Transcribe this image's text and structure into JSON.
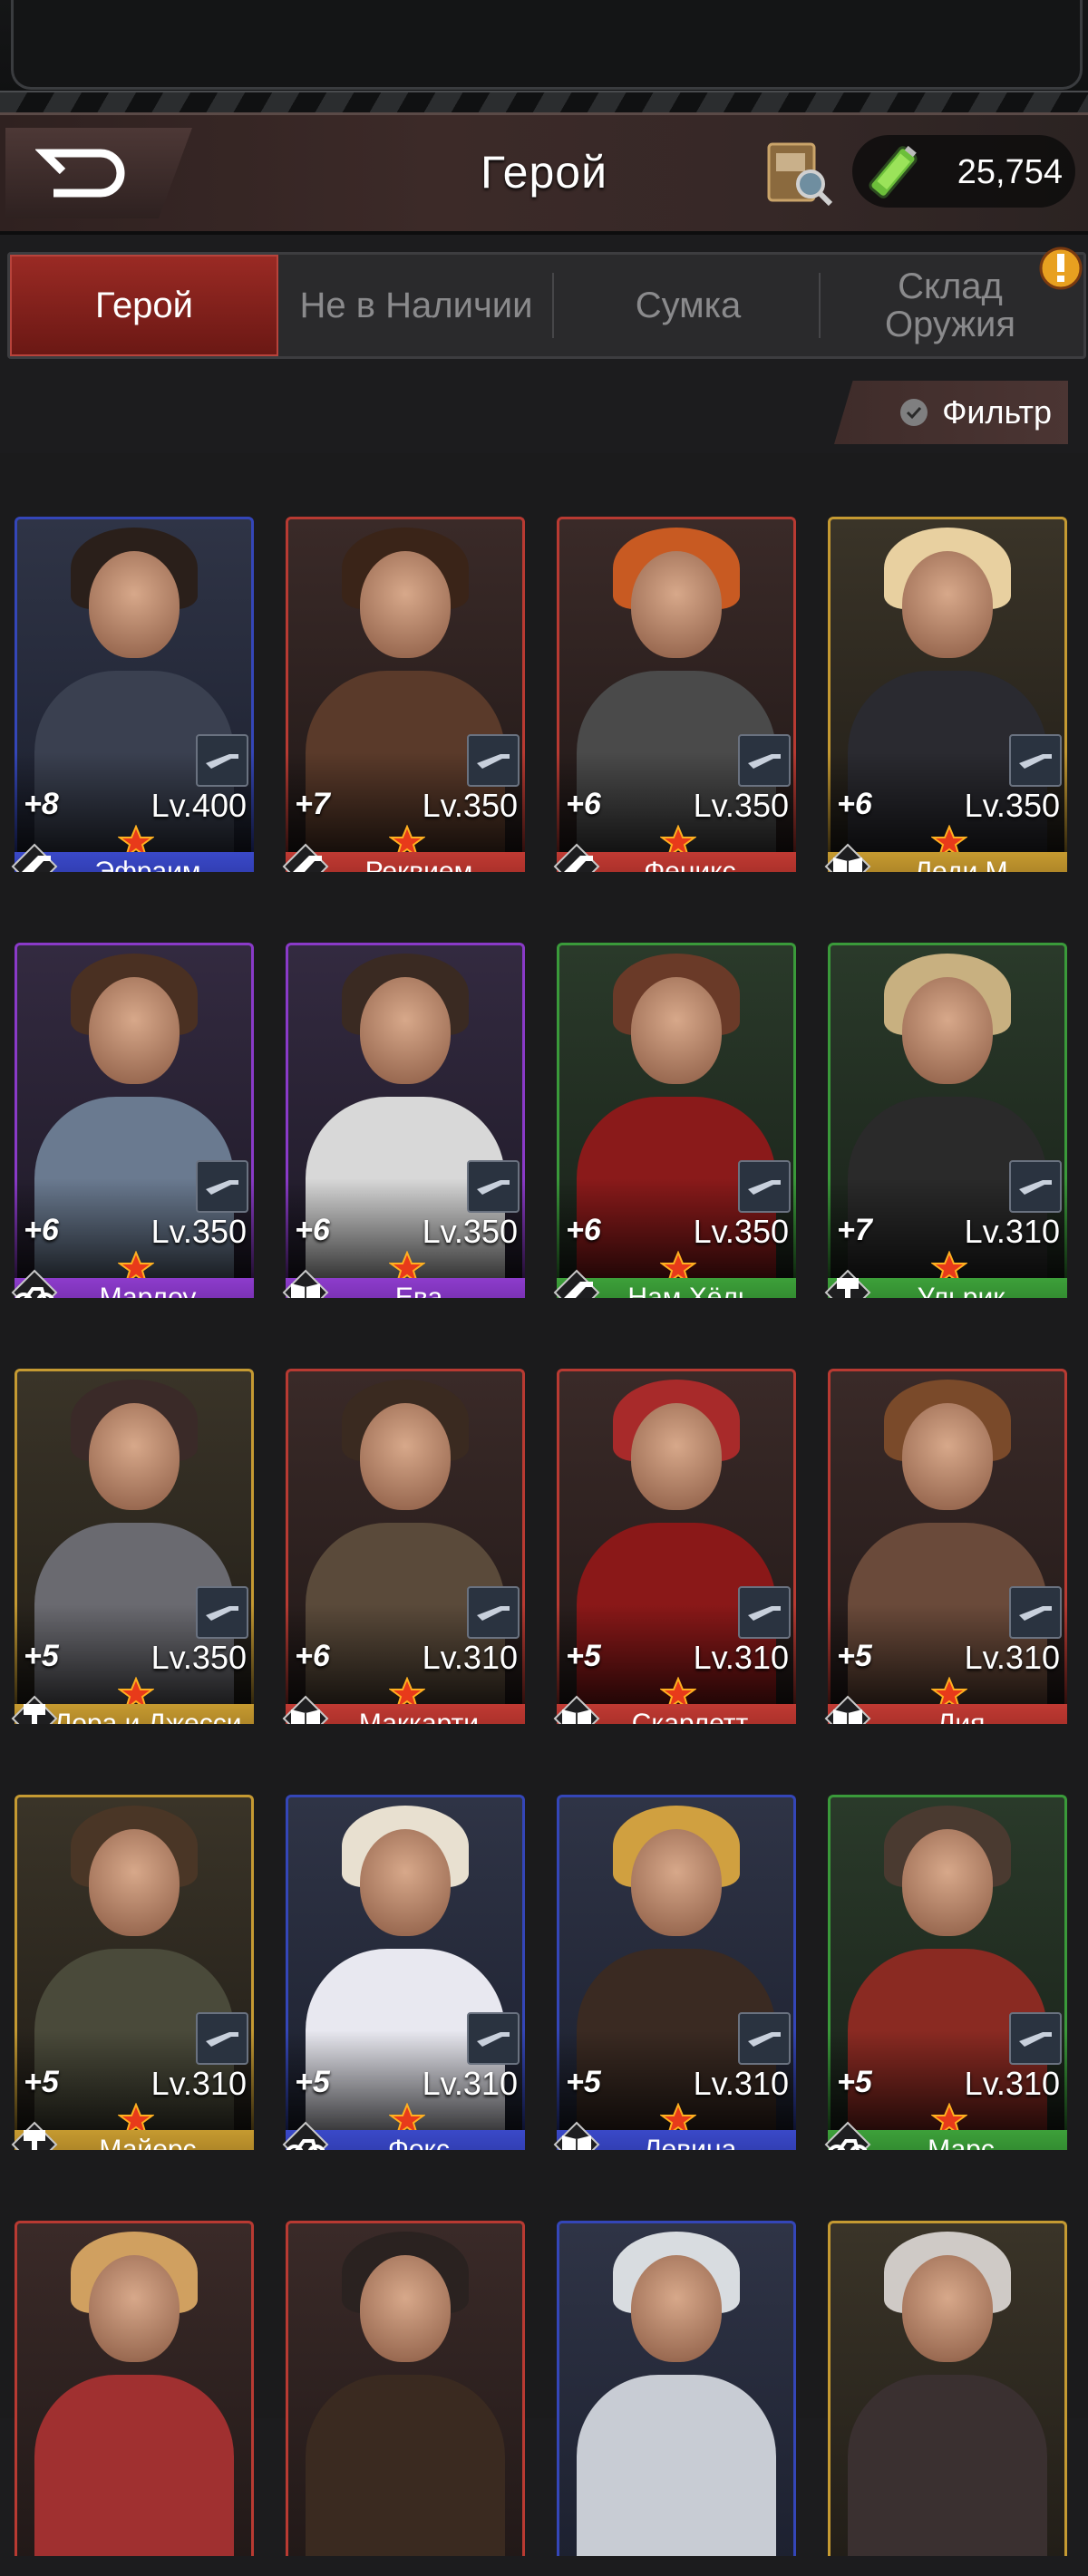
{
  "header": {
    "title": "Герой",
    "currency_value": "25,754",
    "back_icon": "back-arrow-icon",
    "book_icon": "hero-book-search-icon",
    "currency_icon": "green-battery-icon"
  },
  "tabs": [
    {
      "label": "Герой",
      "active": true
    },
    {
      "label": "Не в Наличии",
      "active": false
    },
    {
      "label": "Сумка",
      "active": false
    },
    {
      "label": "Склад Оружия",
      "active": false
    }
  ],
  "filter": {
    "label": "Фильтр"
  },
  "heroes": [
    {
      "name": "Эфраим",
      "plus": "+8",
      "level": "Lv.400",
      "rarity": "blue",
      "class_icon": "rifle-icon"
    },
    {
      "name": "Реквием",
      "plus": "+7",
      "level": "Lv.350",
      "rarity": "red",
      "class_icon": "rifle-icon"
    },
    {
      "name": "Феникс",
      "plus": "+6",
      "level": "Lv.350",
      "rarity": "red",
      "class_icon": "rifle-icon"
    },
    {
      "name": "Леди М",
      "plus": "+6",
      "level": "Lv.350",
      "rarity": "gold",
      "class_icon": "book-icon"
    },
    {
      "name": "Марлоу",
      "plus": "+6",
      "level": "Lv.350",
      "rarity": "purple",
      "class_icon": "motorcycle-icon"
    },
    {
      "name": "Ева",
      "plus": "+6",
      "level": "Lv.350",
      "rarity": "purple",
      "class_icon": "book-icon"
    },
    {
      "name": "Нам Хёль",
      "plus": "+6",
      "level": "Lv.350",
      "rarity": "green",
      "class_icon": "rifle-icon"
    },
    {
      "name": "Ульрик",
      "plus": "+7",
      "level": "Lv.310",
      "rarity": "green",
      "class_icon": "hammer-icon"
    },
    {
      "name": "Лора и Джесси",
      "plus": "+5",
      "level": "Lv.350",
      "rarity": "gold",
      "class_icon": "hammer-icon"
    },
    {
      "name": "Маккарти",
      "plus": "+6",
      "level": "Lv.310",
      "rarity": "red",
      "class_icon": "book-icon"
    },
    {
      "name": "Скарлетт",
      "plus": "+5",
      "level": "Lv.310",
      "rarity": "red",
      "class_icon": "book-icon"
    },
    {
      "name": "Лия",
      "plus": "+5",
      "level": "Lv.310",
      "rarity": "red",
      "class_icon": "book-icon"
    },
    {
      "name": "Майерс",
      "plus": "+5",
      "level": "Lv.310",
      "rarity": "gold",
      "class_icon": "hammer-icon"
    },
    {
      "name": "Фокс",
      "plus": "+5",
      "level": "Lv.310",
      "rarity": "blue",
      "class_icon": "motorcycle-icon"
    },
    {
      "name": "Левина",
      "plus": "+5",
      "level": "Lv.310",
      "rarity": "blue",
      "class_icon": "book-icon"
    },
    {
      "name": "Марс",
      "plus": "+5",
      "level": "Lv.310",
      "rarity": "green",
      "class_icon": "motorcycle-icon"
    },
    {
      "name": "",
      "plus": "",
      "level": "",
      "rarity": "red",
      "class_icon": ""
    },
    {
      "name": "",
      "plus": "",
      "level": "",
      "rarity": "red",
      "class_icon": ""
    },
    {
      "name": "",
      "plus": "",
      "level": "",
      "rarity": "blue",
      "class_icon": ""
    },
    {
      "name": "",
      "plus": "",
      "level": "",
      "rarity": "gold",
      "class_icon": ""
    }
  ],
  "colors": {
    "blue": "#3446b8",
    "red": "#b83a32",
    "gold": "#c59a32",
    "purple": "#8a3ac8",
    "green": "#3a9a3a",
    "active_tab": "#9a2a24"
  }
}
